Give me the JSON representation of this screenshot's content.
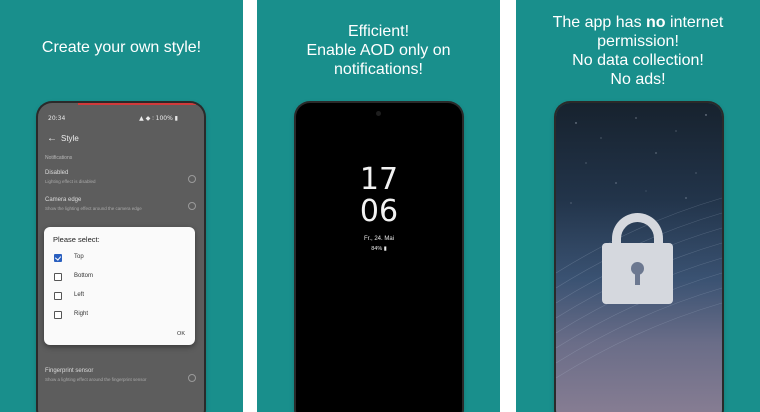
{
  "panels": [
    {
      "caption_lines": [
        "Create your own style!"
      ],
      "phone": {
        "status_time": "20:34",
        "status_right": "▲ ◆ ⫶ 100% ▮",
        "appbar_title": "Style",
        "section_label": "Notifications",
        "settings": [
          {
            "title": "Disabled",
            "subtitle": "Lighting effect is disabled"
          },
          {
            "title": "Camera edge",
            "subtitle": "Show the lighting effect around the camera edge"
          },
          {
            "title": "Fingerprint sensor",
            "subtitle": "Show a lighting effect around the fingerprint sensor"
          }
        ],
        "dialog": {
          "title": "Please select:",
          "options": [
            {
              "label": "Top",
              "checked": true
            },
            {
              "label": "Bottom",
              "checked": false
            },
            {
              "label": "Left",
              "checked": false
            },
            {
              "label": "Right",
              "checked": false
            }
          ],
          "ok_label": "OK"
        }
      }
    },
    {
      "caption_lines": [
        "Efficient!",
        "Enable AOD only on",
        "notifications!"
      ],
      "phone": {
        "hours": "17",
        "minutes": "06",
        "date": "Fr., 24. Mai",
        "battery": "84% ▮"
      }
    },
    {
      "caption_lines": [
        {
          "before": "The app has ",
          "bold": "no",
          "after": " internet"
        },
        "permission!",
        "No data collection!",
        "No ads!"
      ]
    }
  ],
  "colors": {
    "panel_bg": "#198f8c",
    "checkbox_accent": "#2a5fbf",
    "phone1_accent": "#d23a3a"
  }
}
